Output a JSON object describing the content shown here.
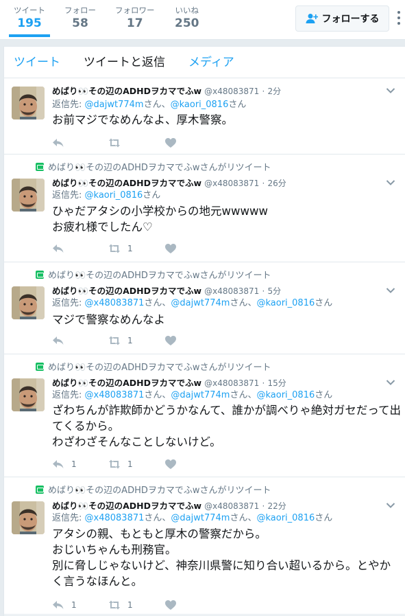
{
  "stats": [
    {
      "label": "ツイート",
      "value": "195",
      "active": true
    },
    {
      "label": "フォロー",
      "value": "58"
    },
    {
      "label": "フォロワー",
      "value": "17"
    },
    {
      "label": "いいね",
      "value": "250"
    }
  ],
  "follow_button": {
    "label": "フォローする",
    "icon": "add-user-icon"
  },
  "more_icon": "vertical-dots-icon",
  "tabs": [
    {
      "label": "ツイート",
      "active": true
    },
    {
      "label": "ツイートと返信"
    },
    {
      "label": "メディア"
    }
  ],
  "colors": {
    "accent": "#1da1f2",
    "retweet": "#17bf63",
    "muted": "#657786"
  },
  "tweets": [
    {
      "retweet_context": "",
      "name": "めばり👀その辺のADHDヲカマでふw",
      "handle": "@x48083871",
      "dot": "·",
      "time": "2分",
      "reply_label": "返信先:",
      "mentions": [
        {
          "handle": "@dajwt774m",
          "suffix": "さん、"
        },
        {
          "handle": "@kaori_0816",
          "suffix": "さん"
        }
      ],
      "text": "お前マジでなめんなよ、厚木警察。",
      "reply_count": "",
      "retweet_count": "",
      "like_count": ""
    },
    {
      "retweet_context": "めばり👀その辺のADHDヲカマでふwさんがリツイート",
      "name": "めばり👀その辺のADHDヲカマでふw",
      "handle": "@x48083871",
      "dot": "·",
      "time": "26分",
      "reply_label": "返信先:",
      "mentions": [
        {
          "handle": "@kaori_0816",
          "suffix": "さん"
        }
      ],
      "text": "ひゃだアタシの小学校からの地元wwwww\nお疲れ様でしたん♡",
      "reply_count": "",
      "retweet_count": "1",
      "like_count": ""
    },
    {
      "retweet_context": "めばり👀その辺のADHDヲカマでふwさんがリツイート",
      "name": "めばり👀その辺のADHDヲカマでふw",
      "handle": "@x48083871",
      "dot": "·",
      "time": "5分",
      "reply_label": "返信先:",
      "mentions": [
        {
          "handle": "@x48083871",
          "suffix": "さん、"
        },
        {
          "handle": "@dajwt774m",
          "suffix": "さん、"
        },
        {
          "handle": "@kaori_0816",
          "suffix": "さん"
        }
      ],
      "text": "マジで警察なめんなよ",
      "reply_count": "",
      "retweet_count": "1",
      "like_count": ""
    },
    {
      "retweet_context": "めばり👀その辺のADHDヲカマでふwさんがリツイート",
      "name": "めばり👀その辺のADHDヲカマでふw",
      "handle": "@x48083871",
      "dot": "·",
      "time": "15分",
      "reply_label": "返信先:",
      "mentions": [
        {
          "handle": "@x48083871",
          "suffix": "さん、"
        },
        {
          "handle": "@dajwt774m",
          "suffix": "さん、"
        },
        {
          "handle": "@kaori_0816",
          "suffix": "さん"
        }
      ],
      "text": "ざわちんが詐欺師かどうかなんて、誰かが調べりゃ絶対ガセだって出てくるから。\nわざわざそんなことしないけど。",
      "reply_count": "1",
      "retweet_count": "1",
      "like_count": ""
    },
    {
      "retweet_context": "めばり👀その辺のADHDヲカマでふwさんがリツイート",
      "name": "めばり👀その辺のADHDヲカマでふw",
      "handle": "@x48083871",
      "dot": "·",
      "time": "22分",
      "reply_label": "返信先:",
      "mentions": [
        {
          "handle": "@x48083871",
          "suffix": "さん、"
        },
        {
          "handle": "@dajwt774m",
          "suffix": "さん、"
        },
        {
          "handle": "@kaori_0816",
          "suffix": "さん"
        }
      ],
      "text": "アタシの親、もともと厚木の警察だから。\nおじいちゃんも刑務官。\n別に脅しじゃないけど、神奈川県警に知り合い超いるから。とやかく言うなほんと。",
      "reply_count": "1",
      "retweet_count": "1",
      "like_count": ""
    }
  ]
}
